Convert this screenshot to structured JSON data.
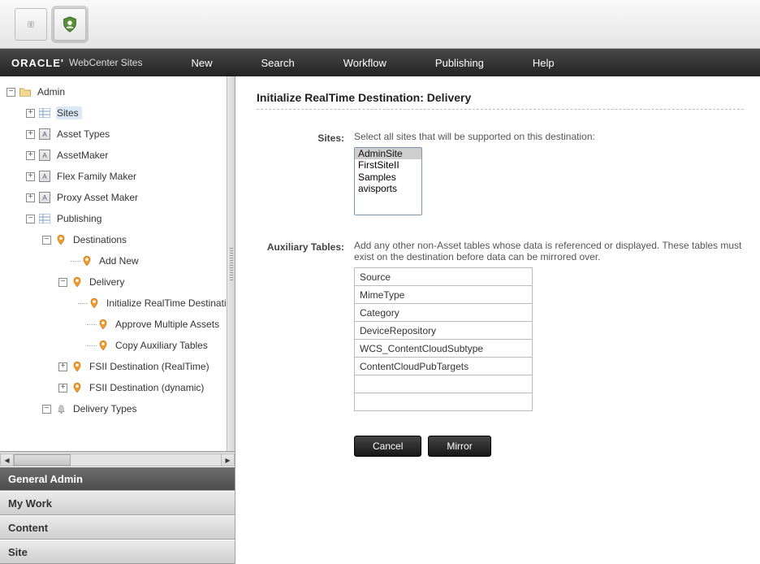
{
  "brand": {
    "oracle": "ORACLE'",
    "product": "WebCenter Sites"
  },
  "menu": [
    "New",
    "Search",
    "Workflow",
    "Publishing",
    "Help"
  ],
  "tree": {
    "root": "Admin",
    "items": [
      {
        "label": "Sites",
        "indent": 1,
        "icon": "grid",
        "exp": "+",
        "selected": true
      },
      {
        "label": "Asset Types",
        "indent": 1,
        "icon": "box-a",
        "exp": "+"
      },
      {
        "label": "AssetMaker",
        "indent": 1,
        "icon": "box-a",
        "exp": "+"
      },
      {
        "label": "Flex Family Maker",
        "indent": 1,
        "icon": "box-a",
        "exp": "+"
      },
      {
        "label": "Proxy Asset Maker",
        "indent": 1,
        "icon": "box-a",
        "exp": "+"
      },
      {
        "label": "Publishing",
        "indent": 1,
        "icon": "grid",
        "exp": "-"
      },
      {
        "label": "Destinations",
        "indent": 2,
        "icon": "pin",
        "exp": "-"
      },
      {
        "label": "Add New",
        "indent": 3,
        "icon": "pin",
        "exp": ""
      },
      {
        "label": "Delivery",
        "indent": 3,
        "icon": "pin",
        "exp": "-"
      },
      {
        "label": "Initialize RealTime Destination",
        "indent": 4,
        "icon": "pin",
        "exp": ""
      },
      {
        "label": "Approve Multiple Assets",
        "indent": 4,
        "icon": "pin",
        "exp": ""
      },
      {
        "label": "Copy Auxiliary Tables",
        "indent": 4,
        "icon": "pin",
        "exp": ""
      },
      {
        "label": "FSII Destination (RealTime)",
        "indent": 3,
        "icon": "pin",
        "exp": "+"
      },
      {
        "label": "FSII Destination (dynamic)",
        "indent": 3,
        "icon": "pin",
        "exp": "+"
      },
      {
        "label": "Delivery Types",
        "indent": 2,
        "icon": "bell",
        "exp": "-"
      }
    ]
  },
  "accordion": [
    "General Admin",
    "My Work",
    "Content",
    "Site"
  ],
  "accordion_active": 0,
  "page": {
    "title": "Initialize RealTime Destination: Delivery",
    "sites_label": "Sites:",
    "sites_hint": "Select all sites that will be supported on this destination:",
    "sites_options": [
      "AdminSite",
      "FirstSiteII",
      "Samples",
      "avisports"
    ],
    "sites_selected": "AdminSite",
    "aux_label": "Auxiliary Tables:",
    "aux_hint": "Add any other non-Asset tables whose data is referenced or displayed. These tables must exist on the destination before data can be mirrored over.",
    "aux_values": [
      "Source",
      "MimeType",
      "Category",
      "DeviceRepository",
      "WCS_ContentCloudSubtype",
      "ContentCloudPubTargets",
      "",
      ""
    ],
    "btn_cancel": "Cancel",
    "btn_mirror": "Mirror"
  }
}
